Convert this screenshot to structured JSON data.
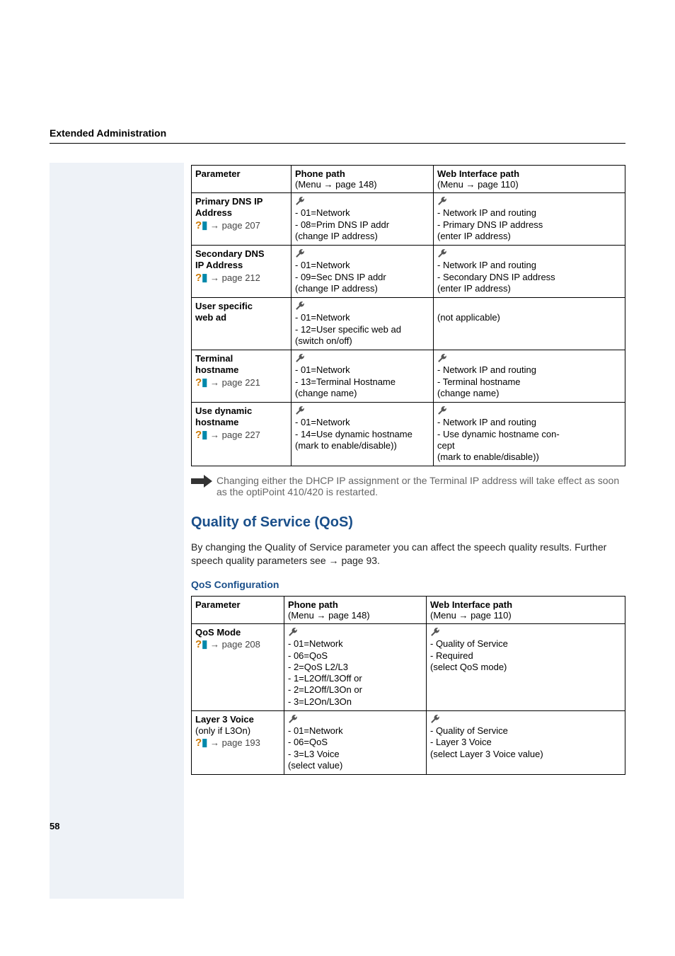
{
  "pageHeader": "Extended Administration",
  "pageNumber": "58",
  "table1": {
    "head": {
      "c1": "Parameter",
      "c2a": "Phone path",
      "c2b": "(Menu → page 148)",
      "c3a": "Web Interface path",
      "c3b": "(Menu → page 110)"
    },
    "rows": [
      {
        "p_lines": [
          "Primary DNS IP",
          "Address"
        ],
        "p_link": " → page 207",
        "phone": [
          "- 01=Network",
          "- 08=Prim DNS IP addr",
          "(change IP address)"
        ],
        "web": [
          "- Network IP and routing",
          "- Primary DNS IP address",
          "(enter IP address)"
        ]
      },
      {
        "p_lines": [
          "Secondary DNS",
          "IP Address"
        ],
        "p_link": " → page 212",
        "phone": [
          "- 01=Network",
          "- 09=Sec DNS IP addr",
          "(change IP address)"
        ],
        "web": [
          "- Network IP and routing",
          "- Secondary DNS IP address",
          "(enter IP address)"
        ]
      },
      {
        "p_lines": [
          "User specific",
          "web ad"
        ],
        "p_link": "",
        "phone": [
          "- 01=Network",
          "- 12=User specific web ad",
          "(switch on/off)"
        ],
        "web": [
          "(not applicable)"
        ]
      },
      {
        "p_lines": [
          "Terminal",
          "hostname"
        ],
        "p_link": " → page 221",
        "phone": [
          "- 01=Network",
          "- 13=Terminal Hostname",
          "(change name)"
        ],
        "web": [
          "- Network IP and routing",
          "- Terminal hostname",
          "(change name)"
        ]
      },
      {
        "p_lines": [
          "Use dynamic",
          "hostname"
        ],
        "p_link": " → page 227",
        "phone": [
          "- 01=Network",
          "- 14=Use dynamic hostname",
          "(mark to enable/disable))"
        ],
        "web": [
          "- Network IP and routing",
          "- Use dynamic hostname con-",
          "cept",
          "(mark to enable/disable))"
        ]
      }
    ]
  },
  "note": "Changing either the DHCP IP assignment or the Terminal IP address will take effect as soon as the optiPoint 410/420 is restarted.",
  "qos": {
    "title": "Quality of Service (QoS)",
    "body": "By changing the Quality of Service parameter you can affect the speech quality results. Further speech quality parameters see → page 93.",
    "subTitle": "QoS Configuration"
  },
  "table2": {
    "head": {
      "c1": "Parameter",
      "c2a": "Phone path",
      "c2b": "(Menu → page 148)",
      "c3a": "Web Interface path",
      "c3b": "(Menu → page 110)"
    },
    "rows": [
      {
        "p_lines": [
          "QoS Mode"
        ],
        "p_link": " → page 208",
        "phone": [
          "- 01=Network",
          "- 06=QoS",
          "- 2=QoS L2/L3",
          "- 1=L2Off/L3Off or",
          "- 2=L2Off/L3On or",
          "- 3=L2On/L3On"
        ],
        "web": [
          "- Quality of Service",
          "- Required",
          "(select QoS mode)"
        ]
      },
      {
        "p_lines": [
          "Layer 3 Voice"
        ],
        "p_extra": "(only if L3On)",
        "p_link": " → page 193",
        "phone": [
          "- 01=Network",
          "- 06=QoS",
          "- 3=L3 Voice",
          "(select value)"
        ],
        "web": [
          "- Quality of Service",
          "- Layer 3 Voice",
          "(select Layer 3 Voice value)"
        ]
      }
    ]
  }
}
